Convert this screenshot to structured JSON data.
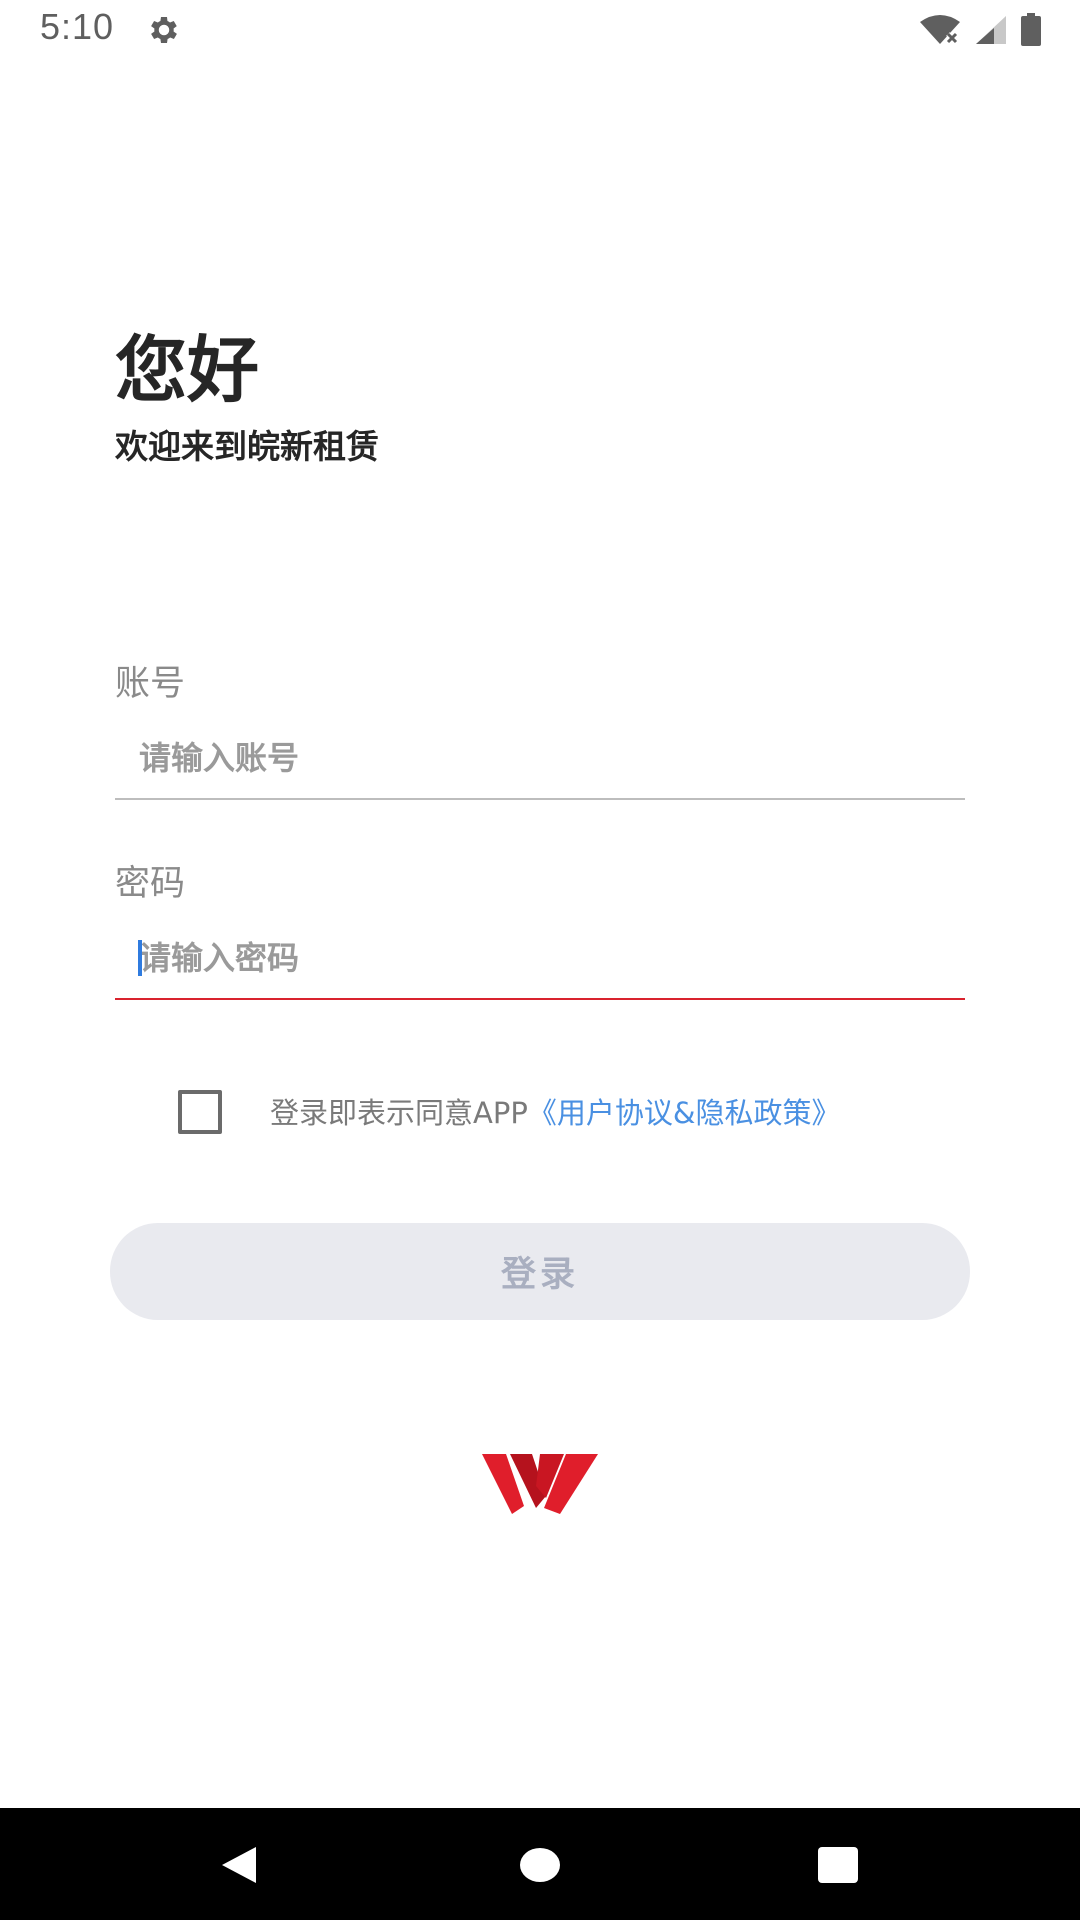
{
  "status_bar": {
    "time": "5:10",
    "icons": [
      "gear-icon",
      "wifi-icon",
      "signal-icon",
      "battery-icon"
    ]
  },
  "greeting": {
    "title": "您好",
    "subtitle": "欢迎来到皖新租赁"
  },
  "form": {
    "account_label": "账号",
    "account_placeholder": "请输入账号",
    "password_label": "密码",
    "password_placeholder": "请输入密码"
  },
  "agreement": {
    "checked": false,
    "text": "登录即表示同意APP",
    "link": "《用户协议&隐私政策》"
  },
  "login_button": {
    "label": "登录"
  },
  "navigation": {
    "icons": [
      "back-icon",
      "home-icon",
      "recents-icon"
    ]
  },
  "colors": {
    "accent_red": "#d9232e",
    "link_blue": "#4a90e2",
    "button_bg": "#e9eaef",
    "button_text": "#a9afc0",
    "title_text": "#262626"
  }
}
